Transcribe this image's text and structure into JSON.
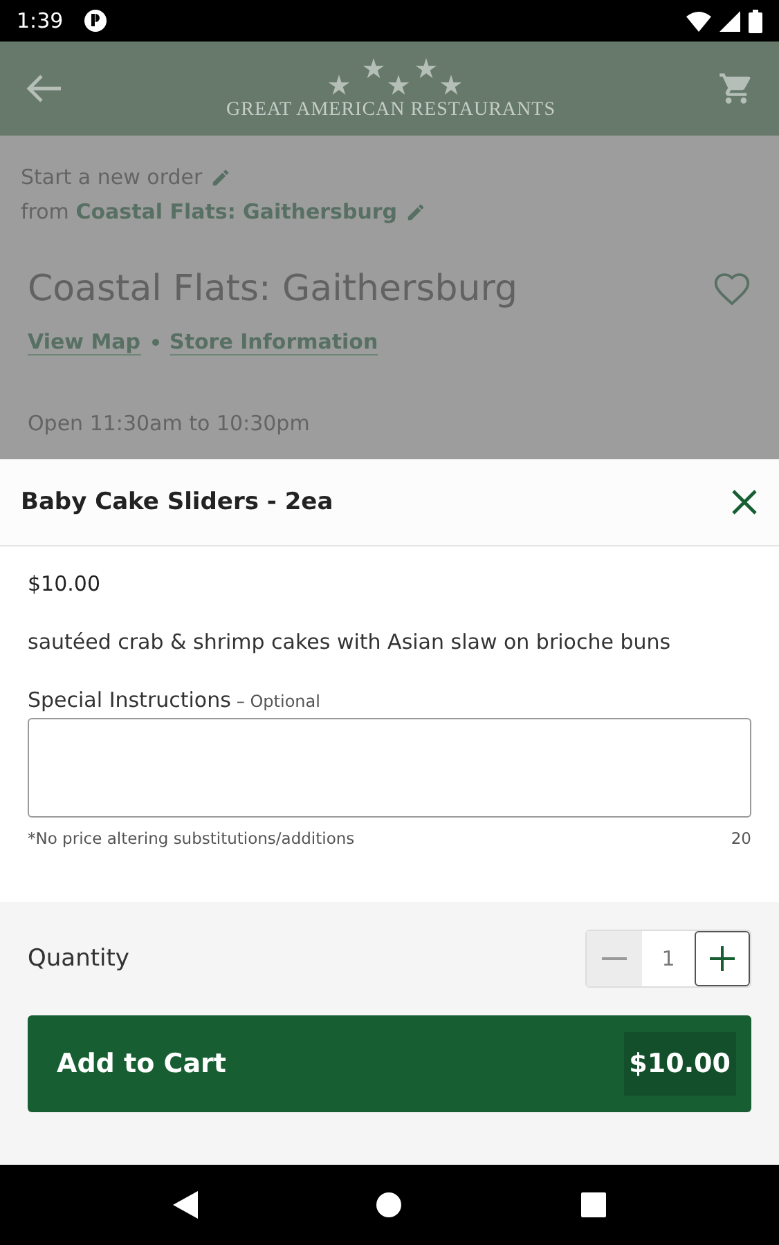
{
  "status_bar": {
    "time": "1:39"
  },
  "header": {
    "logo_text": "GREAT AMERICAN RESTAURANTS"
  },
  "order": {
    "start_label": "Start a new order",
    "from_label": "from",
    "location": "Coastal Flats: Gaithersburg"
  },
  "store": {
    "name": "Coastal Flats: Gaithersburg",
    "favorite": false,
    "links": [
      "View Map",
      "Store Information"
    ],
    "hours": "Open 11:30am to 10:30pm"
  },
  "sheet": {
    "title": "Baby Cake Sliders - 2ea",
    "price": "$10.00",
    "description": "sautéed crab & shrimp cakes with Asian slaw on brioche buns",
    "instructions": {
      "label": "Special Instructions",
      "optional": "– Optional",
      "hint": "*No price altering substitutions/additions",
      "counter": "20"
    },
    "quantity": {
      "label": "Quantity",
      "value": "1",
      "decrement_disabled": true,
      "increment_disabled": false
    },
    "add_button": {
      "label": "Add to Cart",
      "total": "$10.00"
    }
  }
}
